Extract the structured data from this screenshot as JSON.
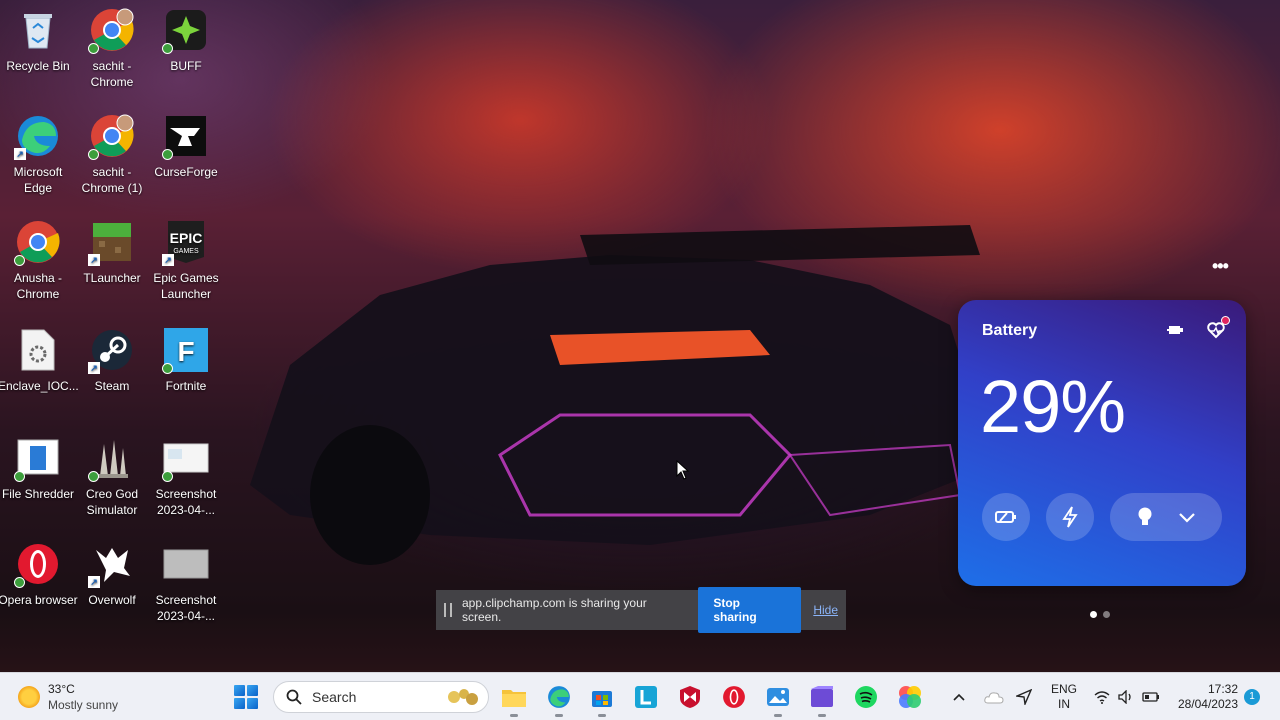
{
  "desktop": {
    "icons": [
      {
        "label": "Recycle Bin",
        "icon": "recycle-bin-icon"
      },
      {
        "label": "sachit - Chrome",
        "icon": "chrome-icon"
      },
      {
        "label": "BUFF",
        "icon": "buff-icon"
      },
      {
        "label": "Microsoft Edge",
        "icon": "edge-icon"
      },
      {
        "label": "sachit - Chrome (1)",
        "icon": "chrome-icon"
      },
      {
        "label": "CurseForge",
        "icon": "curseforge-icon"
      },
      {
        "label": "Anusha - Chrome",
        "icon": "chrome-icon"
      },
      {
        "label": "TLauncher",
        "icon": "tlauncher-icon"
      },
      {
        "label": "Epic Games Launcher",
        "icon": "epic-games-icon",
        "logo_text": "EPIC GAMES"
      },
      {
        "label": "Enclave_IOC...",
        "icon": "file-settings-icon"
      },
      {
        "label": "Steam",
        "icon": "steam-icon"
      },
      {
        "label": "Fortnite",
        "icon": "fortnite-icon",
        "logo_text": "F"
      },
      {
        "label": "File Shredder",
        "icon": "file-shredder-icon"
      },
      {
        "label": "Creo God Simulator",
        "icon": "creo-god-simulator-icon"
      },
      {
        "label": "Screenshot 2023-04-...",
        "icon": "image-file-icon"
      },
      {
        "label": "Opera browser",
        "icon": "opera-icon"
      },
      {
        "label": "Overwolf",
        "icon": "overwolf-icon"
      },
      {
        "label": "Screenshot 2023-04-...",
        "icon": "image-file-icon"
      }
    ]
  },
  "sharing_bar": {
    "message": "app.clipchamp.com is sharing your screen.",
    "stop_label": "Stop sharing",
    "hide_label": "Hide"
  },
  "battery_widget": {
    "title": "Battery",
    "percent": "29%",
    "menu_icon": "more-dots-icon",
    "accent_start": "#3a1a7a",
    "accent_end": "#1e6fe8"
  },
  "taskbar": {
    "weather": {
      "temp": "33°C",
      "condition": "Mostly sunny"
    },
    "search_placeholder": "Search",
    "apps": [
      "file-explorer-icon",
      "edge-icon",
      "microsoft-store-icon",
      "l-app-icon",
      "mcafee-icon",
      "opera-icon",
      "photos-icon",
      "clipchamp-icon",
      "spotify-icon",
      "color-app-icon"
    ],
    "language": {
      "lang": "ENG",
      "region": "IN"
    },
    "time": "17:32",
    "date": "28/04/2023",
    "notification_count": "1"
  }
}
